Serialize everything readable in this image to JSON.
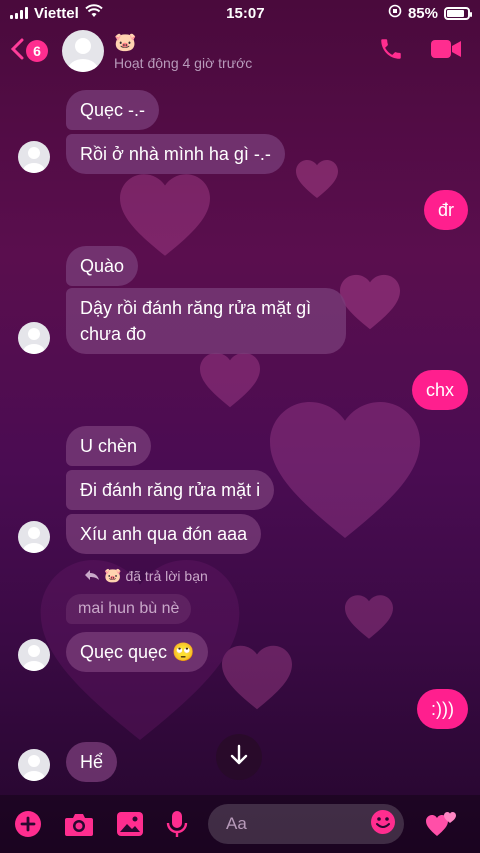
{
  "status_bar": {
    "carrier": "Viettel",
    "time": "15:07",
    "battery": "85%"
  },
  "header": {
    "back_count": "6",
    "contact_emoji": "🐷",
    "active_status": "Hoạt động 4 giờ trước"
  },
  "messages": {
    "m1": "Quẹc -.-",
    "m2": "Rồi ở nhà mình ha gì -.-",
    "m3": "đr",
    "m4": "Quào",
    "m5_l1": "Dậy rồi đánh răng rửa mặt gì",
    "m5_l2": "chưa đo",
    "m6": "chx",
    "m7": "U chèn",
    "m8": "Đi đánh răng rửa mặt i",
    "m9": "Xíu anh qua đón aaa",
    "reply_note": "đã trả lời bạn",
    "reply_quote": "mai hun bù nè",
    "m10": "Quẹc quẹc 🙄",
    "m11": ":)))",
    "m12": "Hể"
  },
  "composer": {
    "placeholder": "Aa"
  },
  "colors": {
    "accent": "#ff1f8e",
    "incoming_bubble": "#783c78"
  }
}
